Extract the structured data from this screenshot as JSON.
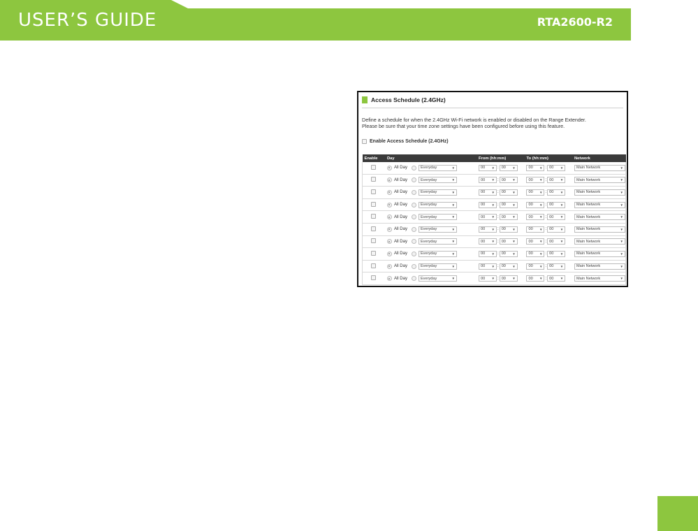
{
  "header": {
    "title": "USER’S GUIDE",
    "model": "RTA2600-R2",
    "color": "#8dc63f"
  },
  "panel": {
    "title": "Access Schedule (2.4GHz)",
    "description_line1": "Define a schedule for when the 2.4GHz Wi-Fi network is enabled or disabled on the Range Extender.",
    "description_line2": "Please be sure that your time zone settings have been configured before using this feature.",
    "enable_label": "Enable Access Schedule (2.4GHz)",
    "columns": {
      "enable": "Enable",
      "day": "Day",
      "from": "From (hh:mm)",
      "to": "To (hh:mm)",
      "network": "Network"
    },
    "rows": [
      {
        "allday_label": "All Day",
        "day": "Everyday",
        "from_h": "00",
        "from_m": "00",
        "to_h": "00",
        "to_m": "00",
        "network": "Main Network"
      },
      {
        "allday_label": "All Day",
        "day": "Everyday",
        "from_h": "00",
        "from_m": "00",
        "to_h": "00",
        "to_m": "00",
        "network": "Main Network"
      },
      {
        "allday_label": "All Day",
        "day": "Everyday",
        "from_h": "00",
        "from_m": "00",
        "to_h": "00",
        "to_m": "00",
        "network": "Main Network"
      },
      {
        "allday_label": "All Day",
        "day": "Everyday",
        "from_h": "00",
        "from_m": "00",
        "to_h": "00",
        "to_m": "00",
        "network": "Main Network"
      },
      {
        "allday_label": "All Day",
        "day": "Everyday",
        "from_h": "00",
        "from_m": "00",
        "to_h": "00",
        "to_m": "00",
        "network": "Main Network"
      },
      {
        "allday_label": "All Day",
        "day": "Everyday",
        "from_h": "00",
        "from_m": "00",
        "to_h": "00",
        "to_m": "00",
        "network": "Main Network"
      },
      {
        "allday_label": "All Day",
        "day": "Everyday",
        "from_h": "00",
        "from_m": "00",
        "to_h": "00",
        "to_m": "00",
        "network": "Main Network"
      },
      {
        "allday_label": "All Day",
        "day": "Everyday",
        "from_h": "00",
        "from_m": "00",
        "to_h": "00",
        "to_m": "00",
        "network": "Main Network"
      },
      {
        "allday_label": "All Day",
        "day": "Everyday",
        "from_h": "00",
        "from_m": "00",
        "to_h": "00",
        "to_m": "00",
        "network": "Main Network"
      },
      {
        "allday_label": "All Day",
        "day": "Everyday",
        "from_h": "00",
        "from_m": "00",
        "to_h": "00",
        "to_m": "00",
        "network": "Main Network"
      }
    ]
  }
}
